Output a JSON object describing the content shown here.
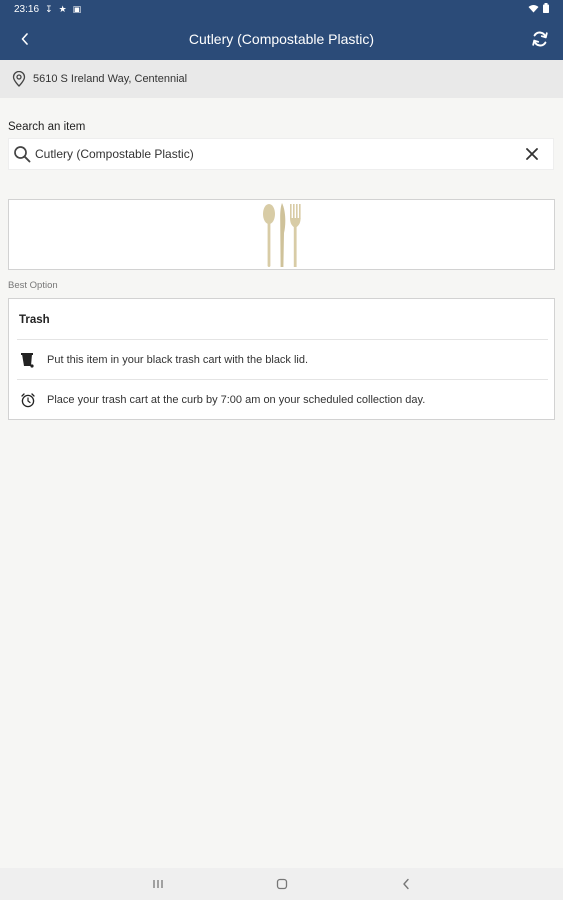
{
  "status_bar": {
    "time": "23:16"
  },
  "app_bar": {
    "title": "Cutlery (Compostable Plastic)"
  },
  "address": {
    "text": "5610 S Ireland Way, Centennial"
  },
  "search": {
    "label": "Search an item",
    "value": "Cutlery (Compostable Plastic)"
  },
  "result": {
    "best_option_label": "Best Option",
    "option": {
      "title": "Trash",
      "instructions": [
        {
          "icon": "trash-cart-icon",
          "text": "Put this item in your black trash cart with the black lid."
        },
        {
          "icon": "alarm-clock-icon",
          "text": "Place your trash cart at the curb by 7:00 am on your scheduled collection day."
        }
      ]
    }
  },
  "colors": {
    "primary": "#2b4b78",
    "cutlery": "#d8cca6",
    "background": "#f6f6f4"
  }
}
